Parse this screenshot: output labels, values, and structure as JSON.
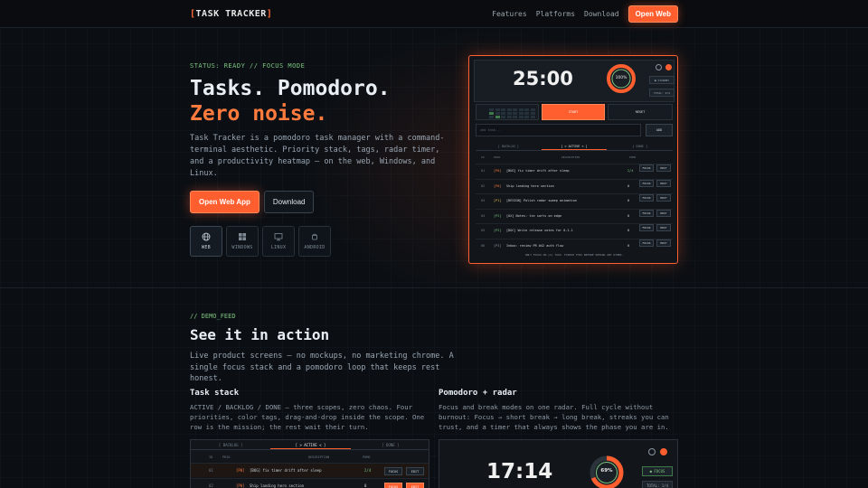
{
  "nav": {
    "logo_open": "[",
    "logo_text": "TASK TRACKER",
    "logo_close": "]",
    "links": [
      "Features",
      "Platforms",
      "Download"
    ],
    "cta": "Open Web"
  },
  "hero": {
    "status": "STATUS: READY // FOCUS MODE",
    "title_line1": "Tasks. Pomodoro.",
    "title_line2": "Zero noise.",
    "description": "Task Tracker is a pomodoro task manager with a command-terminal aesthetic. Priority stack, tags, radar timer, and a productivity heatmap — on the web, Windows, and Linux.",
    "primary_button": "Open Web App",
    "secondary_button": "Download",
    "platforms": [
      {
        "label": "WEB",
        "icon": "globe-icon"
      },
      {
        "label": "WINDOWS",
        "icon": "windows-icon"
      },
      {
        "label": "LINUX",
        "icon": "monitor-icon"
      },
      {
        "label": "ANDROID",
        "icon": "android-icon"
      }
    ]
  },
  "mockup": {
    "timer": "25:00",
    "ring_percent": "100%",
    "ring_fill": 1.0,
    "pill_1": "● STANDBY",
    "pill_2": "TOTAL: 0/4",
    "seg_start": "START",
    "seg_reset": "RESET",
    "input_placeholder": "add task...",
    "add_button": "ADD",
    "tabs": [
      "[ BACKLOG ]",
      "[ > ACTIVE < ]",
      "[ DONE ]"
    ],
    "columns": [
      "ID",
      "PRIO",
      "DESCRIPTION",
      "POMO"
    ],
    "rows": [
      {
        "id": "01",
        "prio": "[P0]",
        "desc": "[BUG] fix timer drift after sleep",
        "pomo": "2/4",
        "focus": "FOCUS",
        "edit": "EDIT"
      },
      {
        "id": "02",
        "prio": "[P0]",
        "desc": "Ship landing hero section",
        "pomo": "0",
        "focus": "FOCUS",
        "edit": "EDIT"
      },
      {
        "id": "03",
        "prio": "[P1]",
        "desc": "[DESIGN] Polish radar sweep animation",
        "pomo": "0",
        "focus": "FOCUS",
        "edit": "EDIT"
      },
      {
        "id": "04",
        "prio": "[P2]",
        "desc": "[UX] Notes: tie sorts on edge",
        "pomo": "0",
        "focus": "FOCUS",
        "edit": "EDIT"
      },
      {
        "id": "05",
        "prio": "[P2]",
        "desc": "[DOC] Write release notes for 0.1.1",
        "pomo": "0",
        "focus": "FOCUS",
        "edit": "EDIT"
      },
      {
        "id": "06",
        "prio": "[P3]",
        "desc": "Inbox: review PR #42 auth flow",
        "pomo": "0",
        "focus": "FOCUS",
        "edit": "EDIT"
      }
    ],
    "footer": "ONLY FOCUS ON [1] TASK. FINISH THIS BEFORE SEEING ANY OTHER."
  },
  "demo": {
    "tag": "// DEMO_FEED",
    "title": "See it in action",
    "description": "Live product screens — no mockups, no marketing chrome. A single focus stack and a pomodoro loop that keeps rest honest.",
    "col1_title": "Task stack",
    "col1_desc": "ACTIVE / BACKLOG / DONE — three scopes, zero chaos. Four priorities, color tags, drag-and-drop inside the scope. One row is the mission; the rest wait their turn.",
    "col2_title": "Pomodoro + radar",
    "col2_desc": "Focus and break modes on one radar. Full cycle without burnout: Focus → short break → long break, streaks you can trust, and a timer that always shows the phase you are in.",
    "shot1": {
      "tabs": [
        "[ BACKLOG ]",
        "[ > ACTIVE < ]",
        "[ DONE ]"
      ],
      "columns": [
        "ID",
        "PRIO",
        "DESCRIPTION",
        "POMO"
      ],
      "rows": [
        {
          "id": "01",
          "prio": "[P0]",
          "desc": "[BUG] fix timer drift after sleep",
          "pomo": "2/4",
          "focus": "FOCUS",
          "edit": "EDIT"
        },
        {
          "id": "02",
          "prio": "[P0]",
          "desc": "Ship landing hero section",
          "pomo": "0",
          "focus": "FOCUS",
          "edit": "EDIT"
        }
      ]
    },
    "shot2": {
      "timer": "17:14",
      "ring_percent": "69%",
      "ring_fill": 0.69,
      "pill_1": "● FOCUS",
      "pill_2": "TOTAL: 1/4"
    }
  },
  "colors": {
    "accent": "#ff5e2f",
    "status_green": "#7cc47f",
    "bg": "#0b0f14"
  }
}
